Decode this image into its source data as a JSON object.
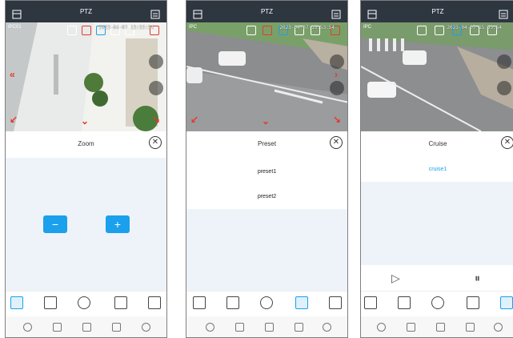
{
  "screens": [
    {
      "title": "PTZ",
      "channel": "IPC01",
      "timestamp": "2023-04-07 15:53:54",
      "panel_title": "Zoom",
      "zoom_out": "−",
      "zoom_in": "+"
    },
    {
      "title": "PTZ",
      "channel": "IPC",
      "timestamp": "2023-04-07 15:53:54",
      "panel_title": "Preset",
      "presets": [
        "preset1",
        "preset2"
      ]
    },
    {
      "title": "PTZ",
      "channel": "IPC",
      "timestamp": "2023-04-07 15:53:54",
      "panel_title": "Cruise",
      "cruises": [
        "cruise1"
      ],
      "play": "▷",
      "pause": "⏸"
    }
  ],
  "close": "✕"
}
